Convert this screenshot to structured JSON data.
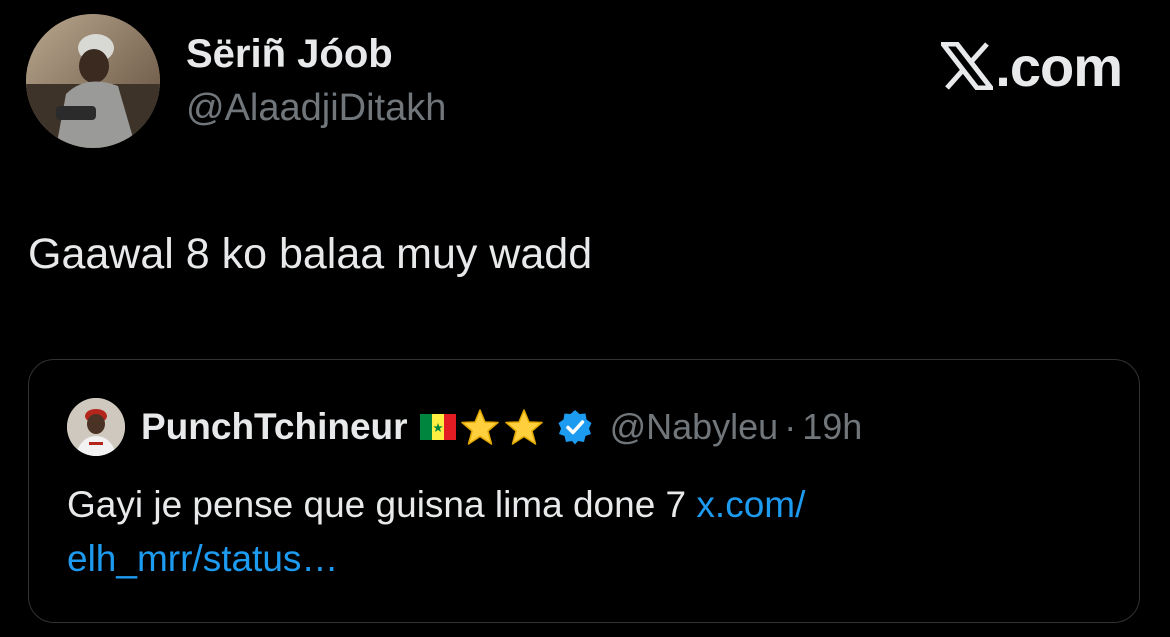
{
  "author": {
    "name": "Sëriñ Jóob",
    "handle": "@AlaadjiDitakh"
  },
  "brand": {
    "text": ".com",
    "icon": "x-logo-icon"
  },
  "tweet": {
    "text": "Gaawal 8 ko balaa muy wadd"
  },
  "quoted_tweet": {
    "name": "PunchTchineur",
    "badges": [
      "senegal-flag-icon",
      "star-icon",
      "star-icon"
    ],
    "verified_icon": "verified-badge-icon",
    "handle": "@Nabyleu",
    "separator": "·",
    "time": "19h",
    "text": "Gayi je pense que guisna lima done 7 ",
    "link_line1": "x.com/",
    "link_line2": "elh_mrr/status…"
  },
  "colors": {
    "background": "#000000",
    "text_primary": "#e7e9ea",
    "text_secondary": "#71767b",
    "link": "#1d9bf0",
    "verified": "#1d9bf0",
    "card_border": "#2f3336"
  }
}
